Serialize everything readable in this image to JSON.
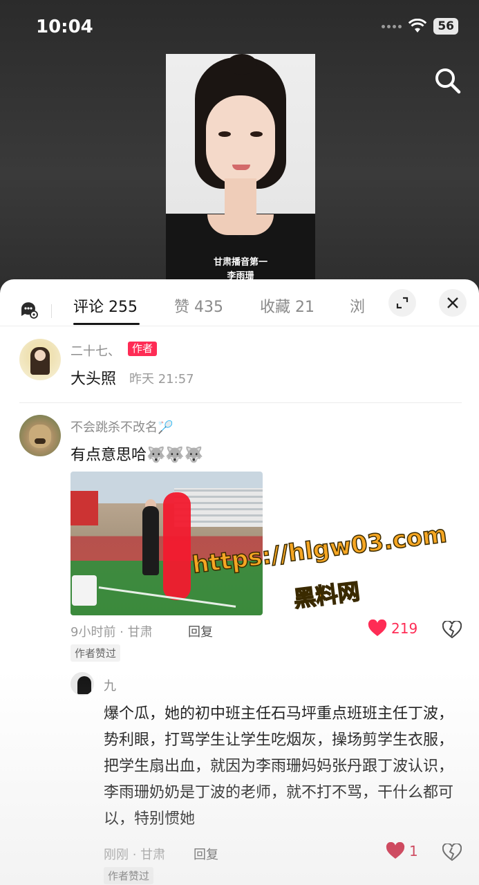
{
  "status_bar": {
    "time": "10:04",
    "battery": "56"
  },
  "video": {
    "caption_line1": "甘肃播音第一",
    "caption_line2": "李雨珊"
  },
  "tabs": {
    "comments": "评论 255",
    "likes": "赞 435",
    "favorites": "收藏 21",
    "views": "浏"
  },
  "comments": [
    {
      "username": "二十七、",
      "author_badge": "作者",
      "text": "大头照",
      "time": "昨天 21:57"
    },
    {
      "username": "不会跳杀不改名🏸",
      "text": "有点意思哈🐺🐺🐺",
      "time": "9小时前 · 甘肃",
      "reply_label": "回复",
      "likes": "219",
      "author_liked": "作者赞过"
    }
  ],
  "reply": {
    "username": "九",
    "text": "爆个瓜，她的初中班主任石马坪重点班班主任丁波，势利眼，打骂学生让学生吃烟灰，操场剪学生衣服，把学生扇出血，就因为李雨珊妈妈张丹跟丁波认识，李雨珊奶奶是丁波的老师，就不打不骂，干什么都可以，特别惯她",
    "time": "刚刚 · 甘肃",
    "reply_label": "回复",
    "likes": "1",
    "author_liked": "作者赞过"
  },
  "watermark": {
    "line1": "https://hlgw03.com",
    "line2": "黑料网"
  },
  "colors": {
    "accent": "#fe2c55",
    "text": "#161616",
    "muted": "#8c8c8c"
  }
}
